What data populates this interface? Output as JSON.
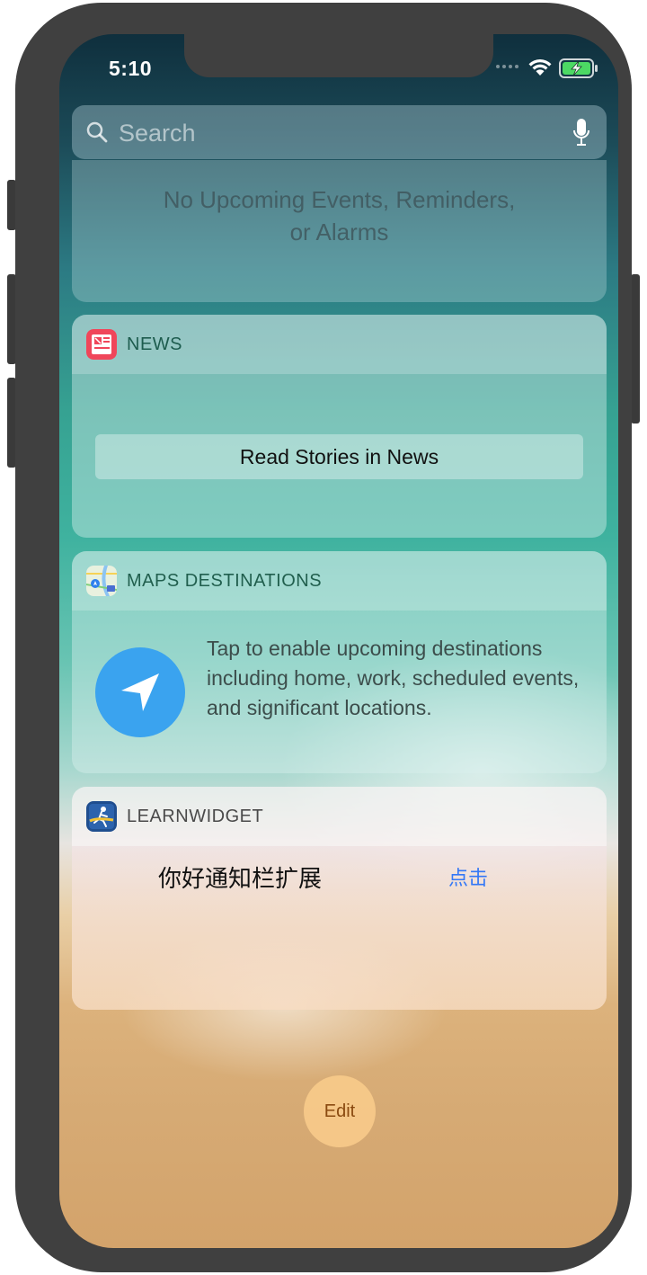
{
  "status_bar": {
    "time": "5:10",
    "icons": [
      "cellular-signal-icon",
      "wifi-icon",
      "battery-charging-icon"
    ]
  },
  "search": {
    "placeholder": "Search",
    "icons": [
      "search-icon",
      "microphone-icon"
    ]
  },
  "upcoming_widget": {
    "message_line1": "No Upcoming Events, Reminders,",
    "message_line2": "or Alarms"
  },
  "news_widget": {
    "title": "NEWS",
    "icon": "news-app-icon",
    "button_label": "Read Stories in News",
    "accent": "#f0465a"
  },
  "maps_widget": {
    "title": "MAPS DESTINATIONS",
    "icon": "maps-app-icon",
    "description": "Tap to enable upcoming destinations including home, work, scheduled events, and significant locations.",
    "circle_color": "#3aa3ef"
  },
  "learn_widget": {
    "title": "LEARNWIDGET",
    "icon": "learnwidget-app-icon",
    "label": "你好通知栏扩展",
    "link": "点击",
    "link_color": "#3478f6"
  },
  "edit_button": {
    "label": "Edit"
  }
}
